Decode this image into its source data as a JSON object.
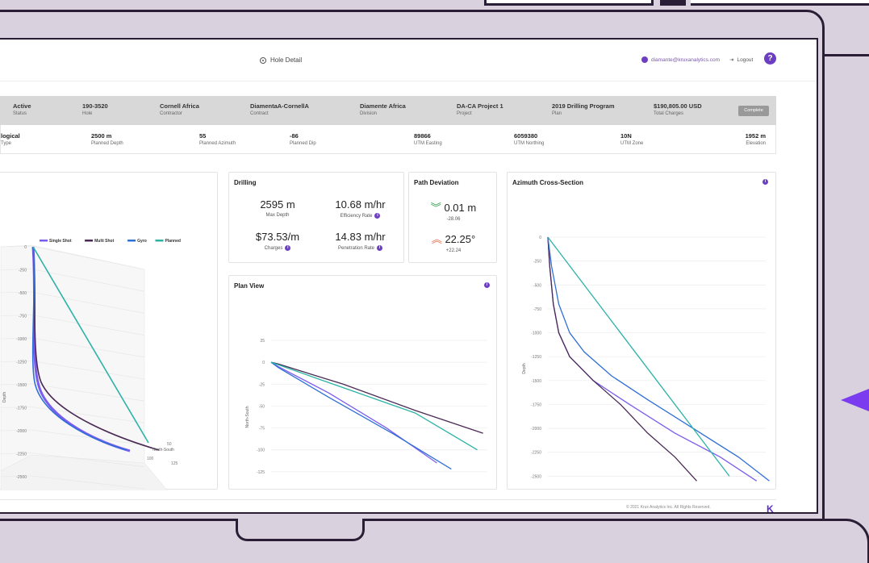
{
  "header": {
    "page_title": "Hole Detail",
    "user_email": "diamante@kruxanalytics.com",
    "logout_label": "Logout",
    "help_label": "?"
  },
  "infobar": {
    "status_value": "Active",
    "status_label": "Status",
    "hole_value": "190-3520",
    "hole_label": "Hole",
    "contractor_value": "Cornell Africa",
    "contractor_label": "Contractor",
    "contract_value": "DiamentaA-CornellA",
    "contract_label": "Contract",
    "division_value": "Diamente Africa",
    "division_label": "Division",
    "project_value": "DA-CA Project 1",
    "project_label": "Project",
    "plan_value": "2019 Drilling Program",
    "plan_label": "Plan",
    "charges_value": "$190,805.00 USD",
    "charges_label": "Total Charges",
    "complete_label": "Complete"
  },
  "details": {
    "type_value": "logical",
    "type_label": "Type",
    "depth_value": "2500 m",
    "depth_label": "Planned Depth",
    "azimuth_value": "55",
    "azimuth_label": "Planned Azimuth",
    "dip_value": "-86",
    "dip_label": "Planned Dip",
    "easting_value": "89866",
    "easting_label": "UTM Easting",
    "northing_value": "6059380",
    "northing_label": "UTM Northing",
    "zone_value": "10N",
    "zone_label": "UTM Zone",
    "elevation_value": "1952 m",
    "elevation_label": "Elevation"
  },
  "drilling": {
    "title": "Drilling",
    "max_depth_value": "2595 m",
    "max_depth_label": "Max Depth",
    "efficiency_value": "10.68 m/hr",
    "efficiency_label": "Efficiency Rate",
    "charges_value": "$73.53/m",
    "charges_label": "Charges",
    "penetration_value": "14.83 m/hr",
    "penetration_label": "Penetration Rate"
  },
  "path_deviation": {
    "title": "Path Deviation",
    "dist_value": "0.01 m",
    "dist_delta": "-28.06",
    "angle_value": "22.25°",
    "angle_delta": "+22.24"
  },
  "colors": {
    "single_shot": "#7b5cf0",
    "multi_shot": "#4a2a55",
    "gyro": "#2f6fd6",
    "planned": "#2bb3a6",
    "accent": "#6c3fc2"
  },
  "chart_data": [
    {
      "type": "line",
      "title": "",
      "legend": [
        "Single Shot",
        "Multi Shot",
        "Gyro",
        "Planned"
      ],
      "legend_position": "top-right",
      "xlabel": "East-West",
      "ylabel": "Depth",
      "zlabel": "North-South",
      "yticks": [
        "0",
        "-250",
        "-500",
        "-750",
        "-1000",
        "-1250",
        "-1500",
        "-1750",
        "-2000",
        "-2250",
        "-2500"
      ],
      "xticks": [
        "25",
        "50",
        "75",
        "100"
      ],
      "zticks": [
        "50",
        "100",
        "125"
      ]
    },
    {
      "type": "line",
      "title": "Plan View",
      "xlabel": "East-West",
      "ylabel": "North-South",
      "xlim": [
        0,
        150
      ],
      "ylim": [
        -150,
        25
      ],
      "xticks": [
        "0",
        "25",
        "50",
        "75",
        "100",
        "125"
      ],
      "yticks": [
        "25",
        "0",
        "-25",
        "-50",
        "-75",
        "-100",
        "-125",
        "-150"
      ],
      "series": [
        {
          "name": "Single Shot",
          "x": [
            0,
            5,
            40,
            80,
            115
          ],
          "y": [
            0,
            -5,
            -35,
            -75,
            -115
          ]
        },
        {
          "name": "Multi Shot",
          "x": [
            0,
            5,
            50,
            100,
            147
          ],
          "y": [
            0,
            -2,
            -25,
            -55,
            -81
          ]
        },
        {
          "name": "Gyro",
          "x": [
            0,
            5,
            40,
            85,
            125
          ],
          "y": [
            0,
            -6,
            -40,
            -82,
            -122
          ]
        },
        {
          "name": "Planned",
          "x": [
            0,
            50,
            100,
            143
          ],
          "y": [
            0,
            -29,
            -58,
            -100
          ]
        }
      ]
    },
    {
      "type": "line",
      "title": "Azimuth Cross-Section",
      "xlabel": "Azimuth",
      "ylabel": "Depth",
      "xlim": [
        0,
        120
      ],
      "ylim": [
        -2750,
        0
      ],
      "xticks": [
        "0",
        "20",
        "40",
        "60",
        "80",
        "100",
        "120"
      ],
      "yticks": [
        "0",
        "-250",
        "-500",
        "-750",
        "-1000",
        "-1250",
        "-1500",
        "-1750",
        "-2000",
        "-2250",
        "-2500",
        "-2750"
      ],
      "series": [
        {
          "name": "Single Shot",
          "x": [
            0,
            1,
            3,
            6,
            12,
            25,
            45,
            70,
            95,
            115
          ],
          "y": [
            0,
            -300,
            -700,
            -1000,
            -1250,
            -1500,
            -1750,
            -2050,
            -2300,
            -2550
          ]
        },
        {
          "name": "Multi Shot",
          "x": [
            0,
            1,
            3,
            6,
            12,
            25,
            40,
            55,
            70,
            82
          ],
          "y": [
            0,
            -300,
            -700,
            -1000,
            -1250,
            -1500,
            -1750,
            -2050,
            -2300,
            -2550
          ]
        },
        {
          "name": "Gyro",
          "x": [
            0,
            2,
            6,
            12,
            20,
            35,
            55,
            80,
            105,
            122
          ],
          "y": [
            0,
            -300,
            -700,
            -1000,
            -1200,
            -1450,
            -1700,
            -2000,
            -2300,
            -2550
          ]
        },
        {
          "name": "Planned",
          "x": [
            0,
            20,
            40,
            60,
            80,
            100
          ],
          "y": [
            0,
            -500,
            -1000,
            -1500,
            -2000,
            -2500
          ]
        }
      ]
    }
  ],
  "footer": {
    "copyright": "© 2021 Krux Analytics Inc. All Rights Reserved.",
    "logo": "K"
  }
}
